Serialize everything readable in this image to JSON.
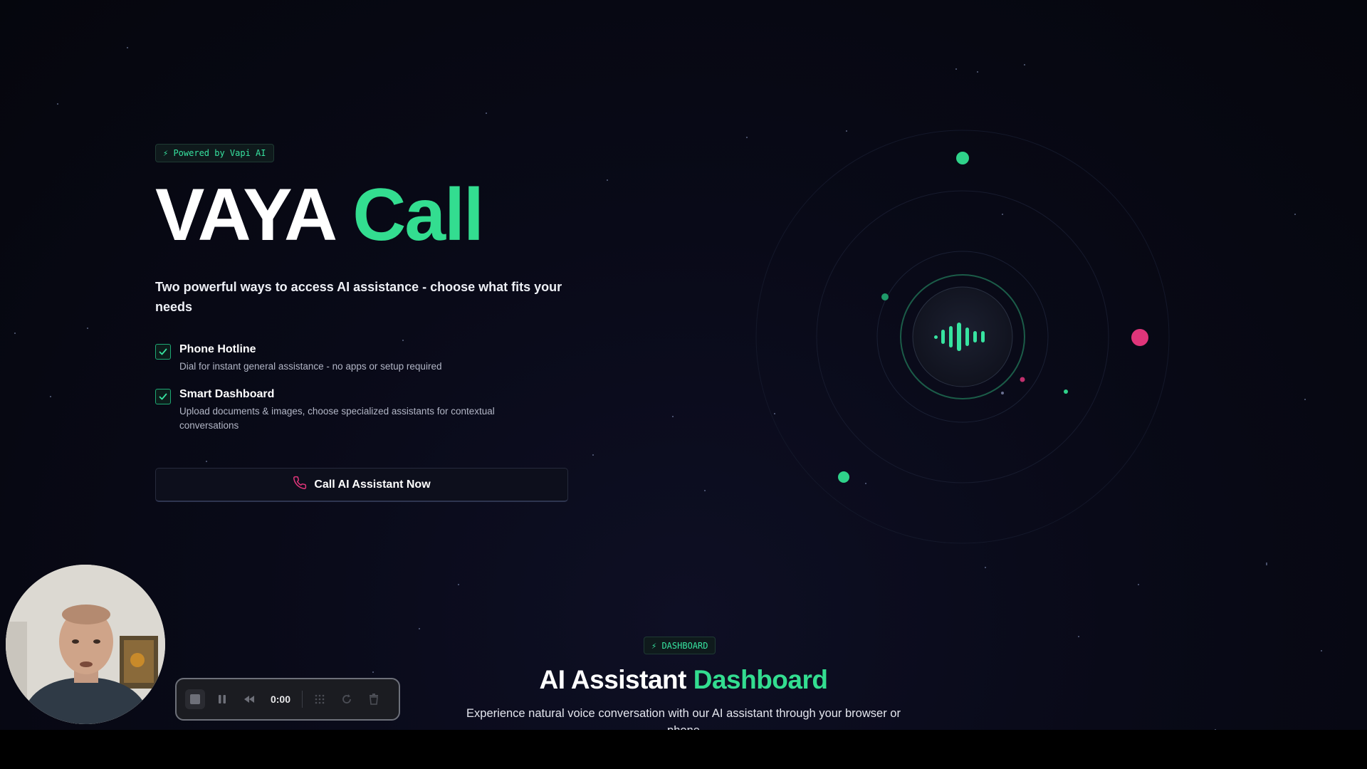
{
  "hero": {
    "badge": "⚡ Powered by Vapi AI",
    "title_main": "VAYA",
    "title_accent": "Call",
    "subtitle": "Two powerful ways to access AI assistance - choose what fits your needs",
    "features": [
      {
        "title": "Phone Hotline",
        "description": "Dial for instant general assistance - no apps or setup required",
        "checked": true
      },
      {
        "title": "Smart Dashboard",
        "description": "Upload documents & images, choose specialized assistants for contextual conversations",
        "checked": true
      }
    ],
    "cta_label": "Call AI Assistant Now",
    "cta_icon": "phone-icon"
  },
  "visual": {
    "center_icon": "waveform-icon"
  },
  "dashboard": {
    "badge": "⚡ DASHBOARD",
    "title_main": "AI Assistant",
    "title_accent": "Dashboard",
    "subtitle": "Experience natural voice conversation with our AI assistant through your browser or phone"
  },
  "recorder": {
    "time": "0:00",
    "icons": [
      "stop-icon",
      "pause-icon",
      "rewind-icon",
      "grid-icon",
      "restart-icon",
      "trash-icon"
    ]
  },
  "colors": {
    "accent": "#33dd90",
    "pink": "#e0357a",
    "background": "#080915"
  }
}
